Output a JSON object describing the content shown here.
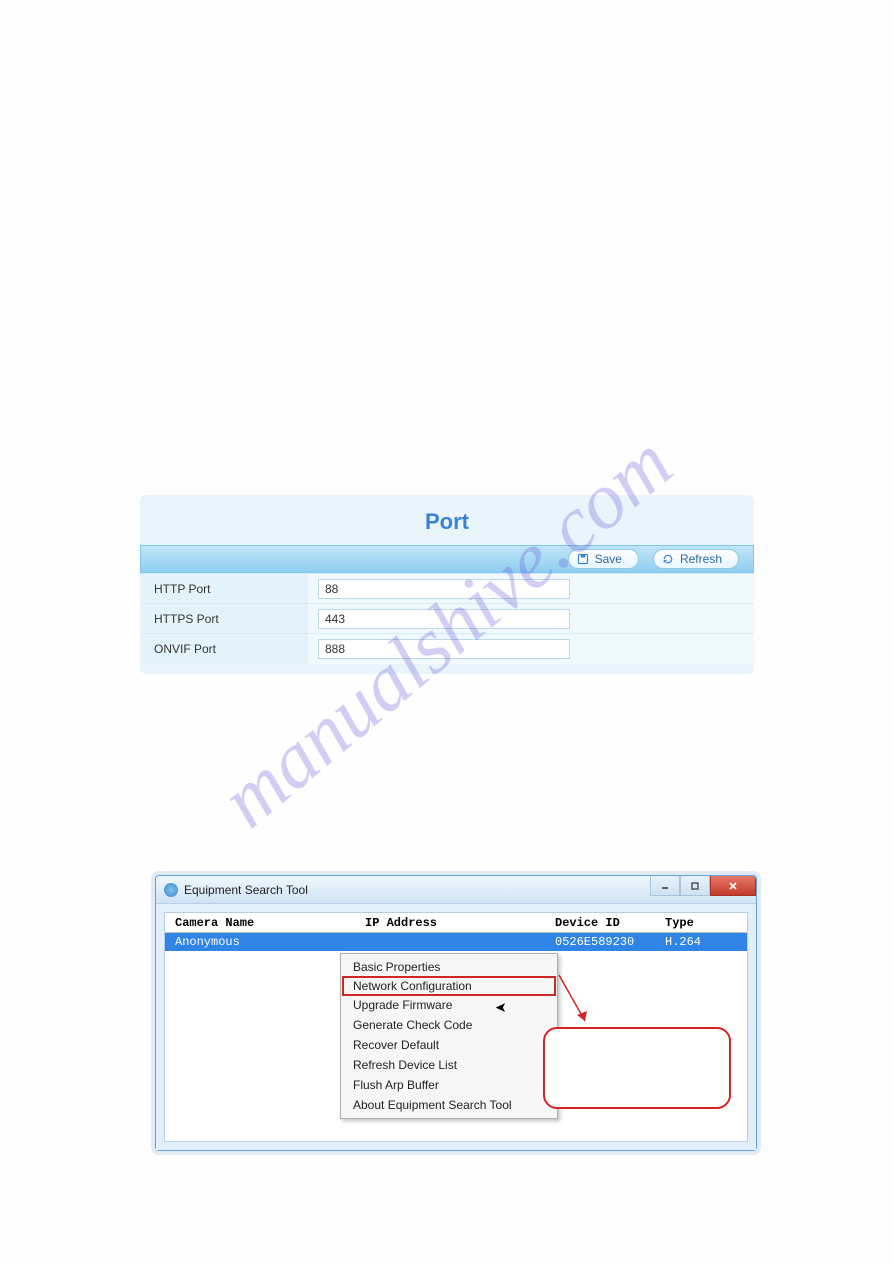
{
  "watermark": "manualshive.com",
  "port_panel": {
    "title": "Port",
    "save_label": "Save",
    "refresh_label": "Refresh",
    "rows": [
      {
        "label": "HTTP Port",
        "value": "88"
      },
      {
        "label": "HTTPS Port",
        "value": "443"
      },
      {
        "label": "ONVIF Port",
        "value": "888"
      }
    ]
  },
  "eq_window": {
    "title": "Equipment Search Tool",
    "columns": {
      "name": "Camera Name",
      "ip": "IP Address",
      "devid": "Device ID",
      "type": "Type"
    },
    "row": {
      "name": "Anonymous",
      "ip": "",
      "devid": "0526E589230",
      "type": "H.264"
    },
    "context_menu": [
      "Basic Properties",
      "Network Configuration",
      "Upgrade Firmware",
      "Generate Check Code",
      "Recover Default",
      "Refresh Device List",
      "Flush Arp Buffer",
      "About Equipment Search Tool"
    ],
    "highlight_index": 1
  }
}
